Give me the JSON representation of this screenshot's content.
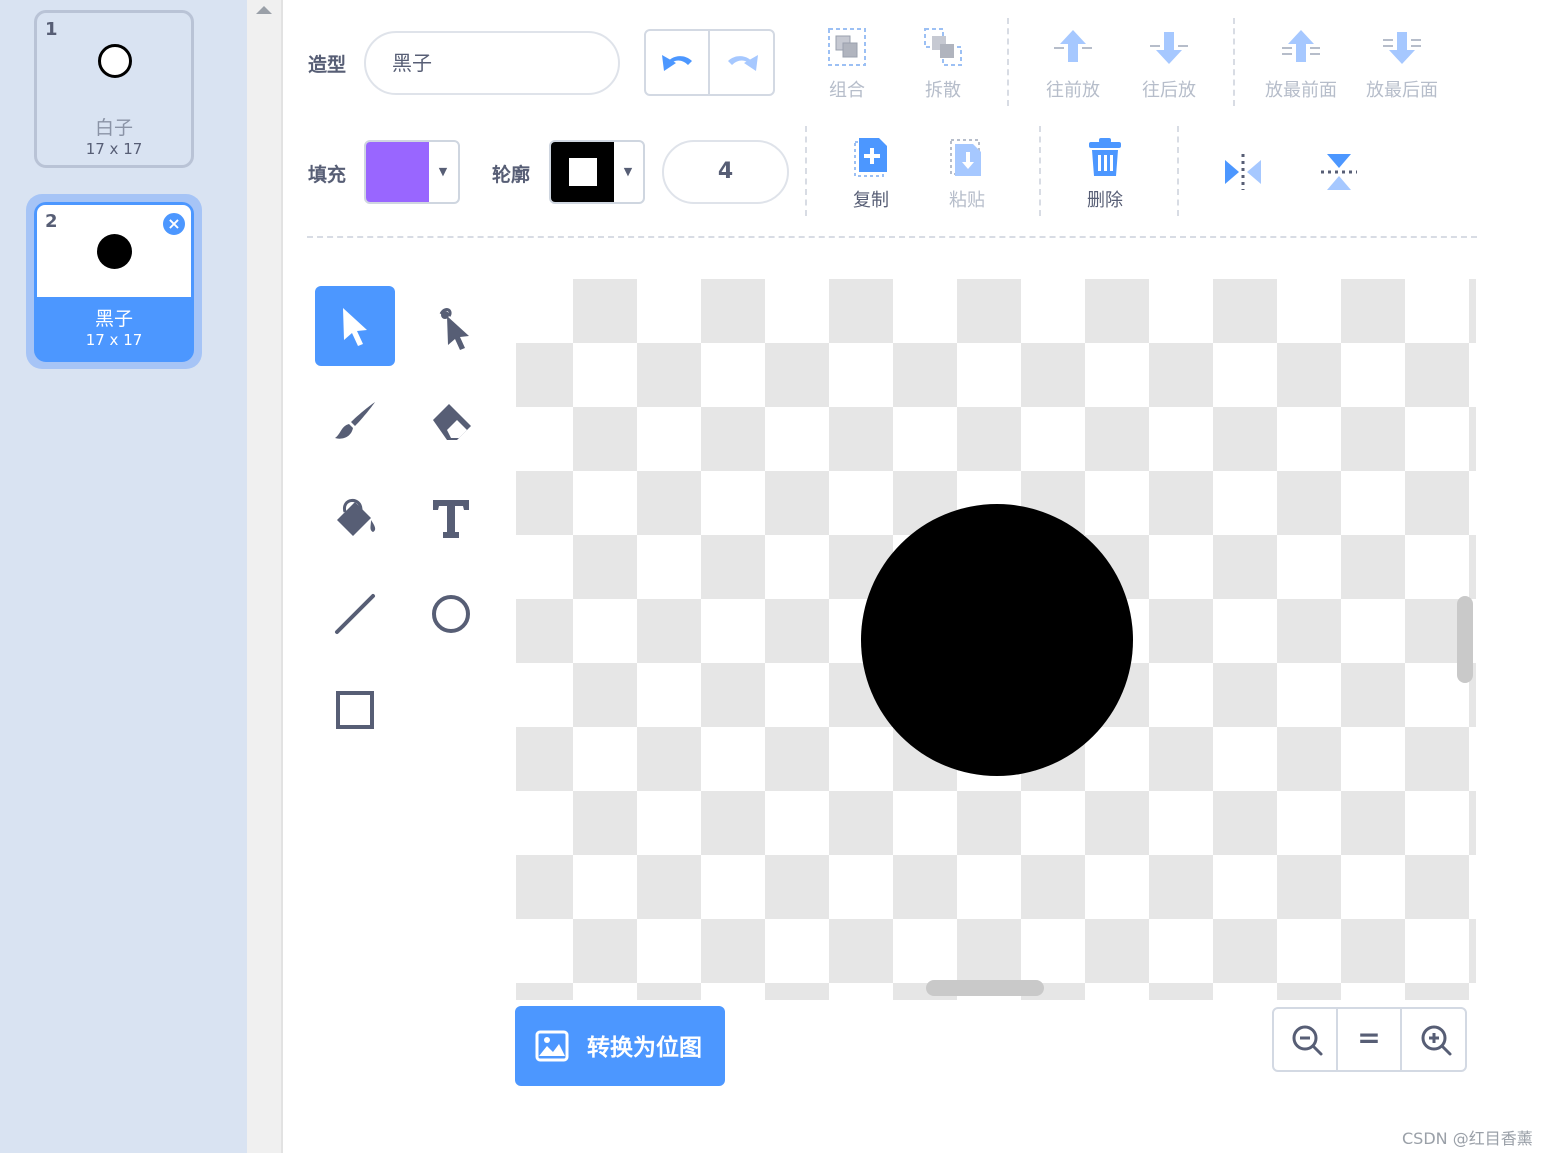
{
  "costume_list": {
    "items": [
      {
        "number": "1",
        "name": "白子",
        "size": "17 x 17"
      },
      {
        "number": "2",
        "name": "黑子",
        "size": "17 x 17"
      }
    ]
  },
  "toolbar": {
    "costume_label": "造型",
    "costume_name": "黑子",
    "group_label": "组合",
    "ungroup_label": "拆散",
    "forward_label": "往前放",
    "backward_label": "往后放",
    "front_label": "放最前面",
    "back_label": "放最后面",
    "fill_label": "填充",
    "outline_label": "轮廓",
    "outline_width": "4",
    "copy_label": "复制",
    "paste_label": "粘贴",
    "delete_label": "删除"
  },
  "colors": {
    "fill": "#9966ff",
    "outline": "#000000",
    "accent": "#4c97ff"
  },
  "tools": [
    "select",
    "reshape",
    "brush",
    "eraser",
    "fill",
    "text",
    "line",
    "circle",
    "rectangle"
  ],
  "convert_button": {
    "label": "转换为位图"
  },
  "zoom": {
    "reset_label": "="
  },
  "watermark": "CSDN @红目香薰"
}
